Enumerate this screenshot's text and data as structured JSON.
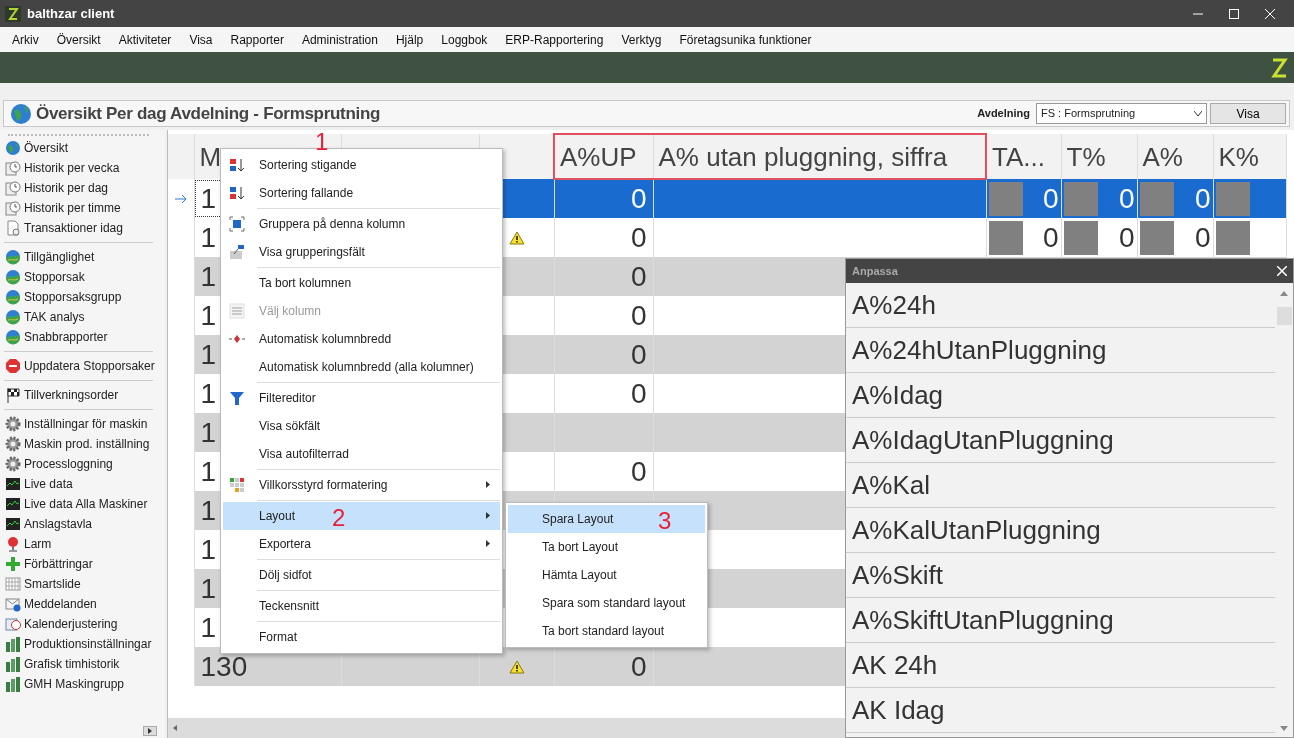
{
  "window": {
    "title": "balthzar client"
  },
  "menu_bar": [
    "Arkiv",
    "Översikt",
    "Aktiviteter",
    "Visa",
    "Rapporter",
    "Administration",
    "Hjälp",
    "Loggbok",
    "ERP-Rapportering",
    "Verktyg",
    "Företagsunika funktioner"
  ],
  "page": {
    "title": "Översikt Per dag Avdelning - Formsprutning",
    "department_label": "Avdelning",
    "department_value": "FS : Formsprutning",
    "show_button": "Visa"
  },
  "sidebar": {
    "groups": [
      [
        {
          "label": "Översikt",
          "kind": "globe"
        },
        {
          "label": "Historik per vecka",
          "kind": "clock"
        },
        {
          "label": "Historik per dag",
          "kind": "clock"
        },
        {
          "label": "Historik per timme",
          "kind": "clock"
        },
        {
          "label": "Transaktioner idag",
          "kind": "document"
        }
      ],
      [
        {
          "label": "Tillgänglighet",
          "kind": "landscape"
        },
        {
          "label": "Stopporsak",
          "kind": "landscape"
        },
        {
          "label": "Stopporsaksgrupp",
          "kind": "landscape"
        },
        {
          "label": "TAK analys",
          "kind": "landscape"
        },
        {
          "label": "Snabbrapporter",
          "kind": "landscape"
        }
      ],
      [
        {
          "label": "Uppdatera Stopporsaker",
          "kind": "stop"
        }
      ],
      [
        {
          "label": "Tillverkningsorder",
          "kind": "flag"
        }
      ],
      [
        {
          "label": "Inställningar för maskin",
          "kind": "gear"
        },
        {
          "label": "Maskin prod. inställning",
          "kind": "gear"
        },
        {
          "label": "Processloggning",
          "kind": "gear"
        },
        {
          "label": "Live data",
          "kind": "monitor"
        },
        {
          "label": "Live data Alla Maskiner",
          "kind": "monitor"
        },
        {
          "label": "Anslagstavla",
          "kind": "monitor"
        },
        {
          "label": "Larm",
          "kind": "alarm"
        },
        {
          "label": "Förbättringar",
          "kind": "plus"
        },
        {
          "label": "Smartslide",
          "kind": "grid"
        },
        {
          "label": "Meddelanden",
          "kind": "mail"
        },
        {
          "label": "Kalenderjustering",
          "kind": "calendar"
        },
        {
          "label": "Produktionsinställningar",
          "kind": "chart"
        },
        {
          "label": "Grafisk timhistorik",
          "kind": "chart"
        },
        {
          "label": "GMH Maskingrupp",
          "kind": "chart"
        }
      ]
    ]
  },
  "table": {
    "columns": [
      {
        "label": "M",
        "highlighted": false
      },
      {
        "highlighted": false
      },
      {
        "highlighted": false
      },
      {
        "label": "A%UP",
        "highlighted": true
      },
      {
        "label": "A% utan pluggning, siffra",
        "highlighted": true
      },
      {
        "label": "TA...",
        "highlighted": false
      },
      {
        "label": "T%",
        "highlighted": false
      },
      {
        "label": "A%",
        "highlighted": false
      },
      {
        "label": "K%",
        "highlighted": false
      }
    ],
    "rows": [
      {
        "id": "1",
        "selected": true,
        "warning": false,
        "a_up": "0",
        "metrics": [
          "0",
          "0",
          "0"
        ]
      },
      {
        "id": "1",
        "selected": false,
        "warning": true,
        "a_up": "0",
        "metrics": [
          "0",
          "0",
          "0"
        ]
      },
      {
        "id": "1",
        "selected": false,
        "warning": false,
        "a_up": "0"
      },
      {
        "id": "1",
        "selected": false,
        "warning": false,
        "a_up": "0"
      },
      {
        "id": "1",
        "selected": false,
        "warning": false,
        "a_up": "0"
      },
      {
        "id": "1",
        "selected": false,
        "warning": false,
        "a_up": "0"
      },
      {
        "id": "1",
        "selected": false,
        "warning": false
      },
      {
        "id": "1",
        "selected": false,
        "warning": false,
        "a_up": "0"
      },
      {
        "id": "1",
        "selected": false
      },
      {
        "id": "1",
        "selected": false
      },
      {
        "id": "1",
        "selected": false
      },
      {
        "id": "1",
        "selected": false
      },
      {
        "id": "130",
        "selected": false,
        "warning": true,
        "a_up": "0"
      }
    ]
  },
  "context_menu": {
    "groups": [
      [
        {
          "label": "Sortering stigande",
          "kind": "sort-asc",
          "selected": false,
          "disabled": false,
          "submenu": false
        },
        {
          "label": "Sortering fallande",
          "kind": "sort-desc",
          "selected": false,
          "disabled": false,
          "submenu": false
        }
      ],
      [
        {
          "label": "Gruppera på denna kolumn",
          "kind": "group",
          "selected": false,
          "disabled": false,
          "submenu": false
        },
        {
          "label": "Visa grupperingsfält",
          "kind": "group-panel",
          "selected": false,
          "disabled": false,
          "submenu": false
        }
      ],
      [
        {
          "label": "Ta bort kolumnen",
          "kind": "plain",
          "selected": false,
          "disabled": false,
          "submenu": false
        },
        {
          "label": "Välj kolumn",
          "kind": "chooser",
          "selected": false,
          "disabled": true,
          "submenu": false
        },
        {
          "label": "Automatisk kolumnbredd",
          "kind": "autowidth",
          "selected": false,
          "disabled": false,
          "submenu": false
        },
        {
          "label": "Automatisk kolumnbredd (alla kolumner)",
          "kind": "plain",
          "selected": false,
          "disabled": false,
          "submenu": false
        }
      ],
      [
        {
          "label": "Filtereditor",
          "kind": "filter",
          "selected": false,
          "disabled": false,
          "submenu": false
        },
        {
          "label": "Visa sökfält",
          "kind": "plain",
          "selected": false,
          "disabled": false,
          "submenu": false
        },
        {
          "label": "Visa autofilterrad",
          "kind": "plain",
          "selected": false,
          "disabled": false,
          "submenu": false
        }
      ],
      [
        {
          "label": "Villkorsstyrd formatering",
          "kind": "format",
          "selected": false,
          "disabled": false,
          "submenu": true
        }
      ],
      [
        {
          "label": "Layout",
          "kind": "plain",
          "selected": true,
          "disabled": false,
          "submenu": true
        },
        {
          "label": "Exportera",
          "kind": "plain",
          "selected": false,
          "disabled": false,
          "submenu": true
        }
      ],
      [
        {
          "label": "Dölj sidfot",
          "kind": "plain",
          "selected": false,
          "disabled": false,
          "submenu": false
        }
      ],
      [
        {
          "label": "Teckensnitt",
          "kind": "plain",
          "selected": false,
          "disabled": false,
          "submenu": false
        }
      ],
      [
        {
          "label": "Format",
          "kind": "plain",
          "selected": false,
          "disabled": false,
          "submenu": false
        }
      ]
    ]
  },
  "submenu": [
    {
      "label": "Spara Layout",
      "selected": true
    },
    {
      "label": "Ta bort Layout",
      "selected": false
    },
    {
      "label": "Hämta Layout",
      "selected": false
    },
    {
      "label": "Spara som standard layout",
      "selected": false
    },
    {
      "label": "Ta bort standard layout",
      "selected": false
    }
  ],
  "customize_panel": {
    "title": "Anpassa",
    "items": [
      "A%24h",
      "A%24hUtanPluggning",
      "A%Idag",
      "A%IdagUtanPluggning",
      "A%Kal",
      "A%KalUtanPluggning",
      "A%Skift",
      "A%SkiftUtanPluggning",
      "AK 24h",
      "AK Idag"
    ]
  },
  "annotations": [
    "1",
    "2",
    "3"
  ]
}
